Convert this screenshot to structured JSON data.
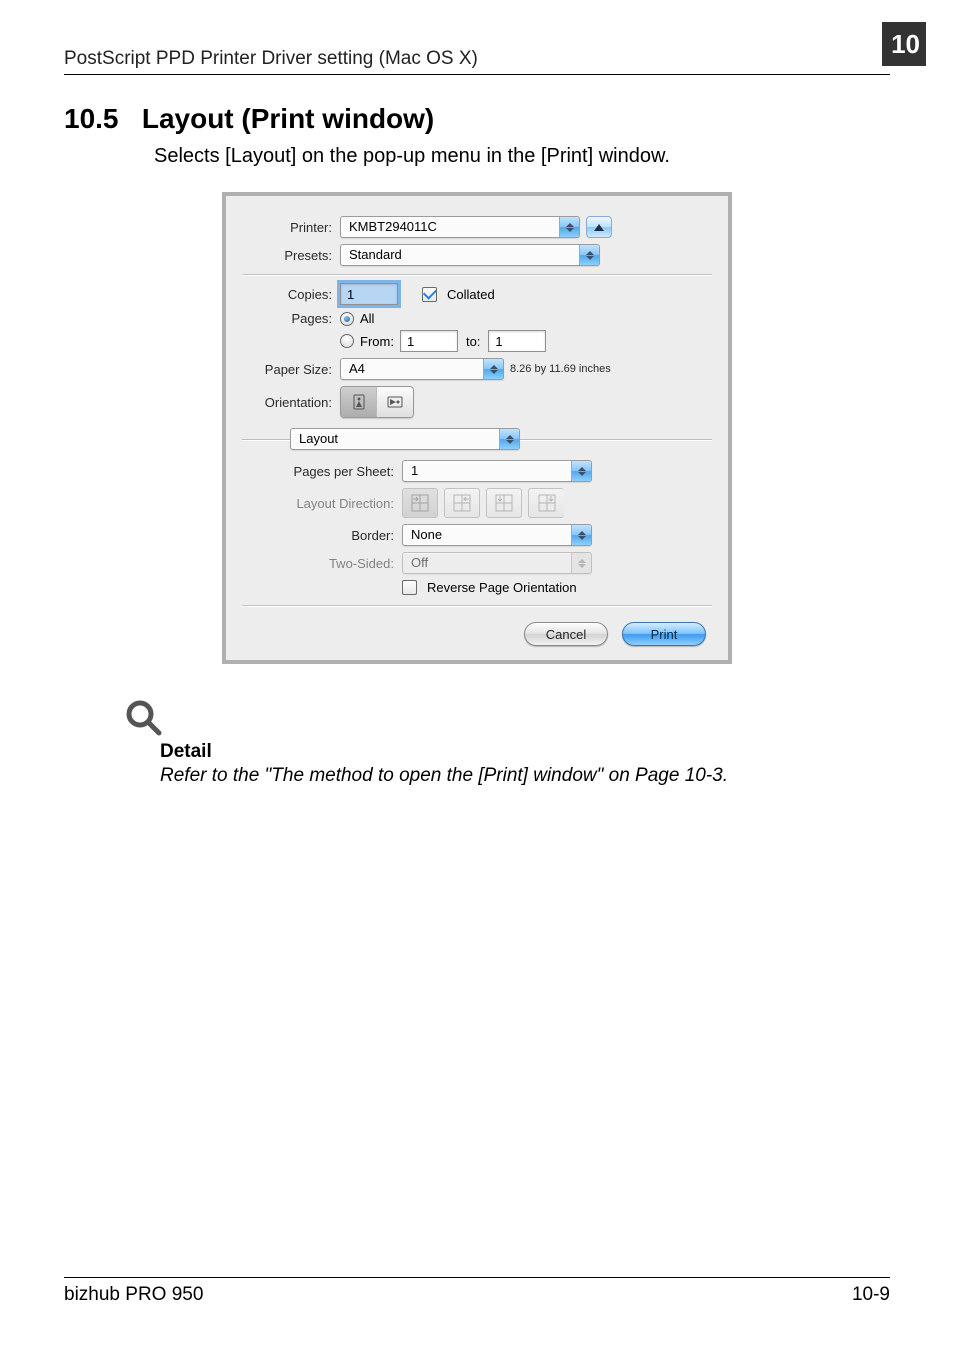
{
  "chapterNumber": "10",
  "headerTitle": "PostScript PPD Printer Driver setting (Mac OS X)",
  "section": {
    "number": "10.5",
    "title": "Layout (Print window)",
    "intro": "Selects [Layout] on the pop-up menu in the [Print] window."
  },
  "dialog": {
    "printer": {
      "label": "Printer:",
      "value": "KMBT294011C"
    },
    "presets": {
      "label": "Presets:",
      "value": "Standard"
    },
    "copies": {
      "label": "Copies:",
      "value": "1",
      "collatedLabel": "Collated"
    },
    "pages": {
      "label": "Pages:",
      "allLabel": "All",
      "fromLabel": "From:",
      "fromValue": "1",
      "toLabel": "to:",
      "toValue": "1"
    },
    "paperSize": {
      "label": "Paper Size:",
      "value": "A4",
      "dimensions": "8.26 by 11.69 inches"
    },
    "orientation": {
      "label": "Orientation:"
    },
    "panel": {
      "name": "Layout"
    },
    "pagesPerSheet": {
      "label": "Pages per Sheet:",
      "value": "1"
    },
    "layoutDirection": {
      "label": "Layout Direction:"
    },
    "border": {
      "label": "Border:",
      "value": "None"
    },
    "twoSided": {
      "label": "Two-Sided:",
      "value": "Off"
    },
    "reverseLabel": "Reverse Page Orientation",
    "buttons": {
      "cancel": "Cancel",
      "print": "Print"
    }
  },
  "detail": {
    "heading": "Detail",
    "body": "Refer to the \"The method to open the [Print] window\" on Page 10-3."
  },
  "footer": {
    "product": "bizhub PRO 950",
    "pageNum": "10-9"
  }
}
